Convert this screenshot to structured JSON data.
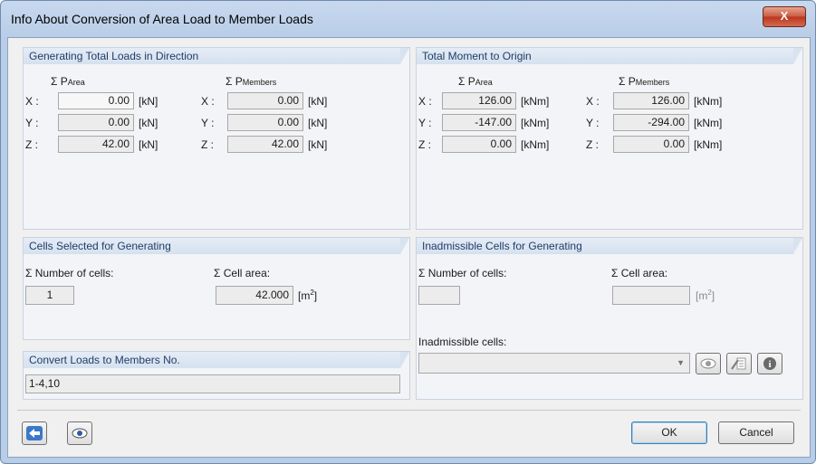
{
  "window": {
    "title": "Info About Conversion of Area Load to Member Loads",
    "close_label": "X"
  },
  "gen_loads": {
    "heading": "Generating Total Loads in Direction",
    "col_area_prefix": "Σ P",
    "col_area_sub": "Area",
    "col_members_prefix": "Σ P",
    "col_members_sub": "Members",
    "rows": [
      {
        "axis": "X :",
        "area": "0.00",
        "area_unit": "[kN]",
        "axis2": "X :",
        "members": "0.00",
        "members_unit": "[kN]"
      },
      {
        "axis": "Y :",
        "area": "0.00",
        "area_unit": "[kN]",
        "axis2": "Y :",
        "members": "0.00",
        "members_unit": "[kN]"
      },
      {
        "axis": "Z :",
        "area": "42.00",
        "area_unit": "[kN]",
        "axis2": "Z :",
        "members": "42.00",
        "members_unit": "[kN]"
      }
    ]
  },
  "moment": {
    "heading": "Total Moment to Origin",
    "col_area_prefix": "Σ P",
    "col_area_sub": "Area",
    "col_members_prefix": "Σ P",
    "col_members_sub": "Members",
    "rows": [
      {
        "axis": "X :",
        "area": "126.00",
        "area_unit": "[kNm]",
        "axis2": "X :",
        "members": "126.00",
        "members_unit": "[kNm]"
      },
      {
        "axis": "Y :",
        "area": "-147.00",
        "area_unit": "[kNm]",
        "axis2": "Y :",
        "members": "-294.00",
        "members_unit": "[kNm]"
      },
      {
        "axis": "Z :",
        "area": "0.00",
        "area_unit": "[kNm]",
        "axis2": "Z :",
        "members": "0.00",
        "members_unit": "[kNm]"
      }
    ]
  },
  "cells_selected": {
    "heading": "Cells Selected for Generating",
    "num_label": "Σ Number of cells:",
    "num_value": "1",
    "area_label": "Σ Cell area:",
    "area_value": "42.000",
    "area_unit": "[m",
    "area_unit_sup": "2",
    "area_unit_end": "]"
  },
  "cells_inadmissible": {
    "heading": "Inadmissible Cells for Generating",
    "num_label": "Σ Number of cells:",
    "num_value": "",
    "area_label": "Σ Cell area:",
    "area_value": "",
    "area_unit": "[m",
    "area_unit_sup": "2",
    "area_unit_end": "]",
    "list_label": "Inadmissible cells:",
    "list_value": ""
  },
  "convert": {
    "heading": "Convert Loads to Members No.",
    "value": "1-4,10"
  },
  "footer": {
    "ok_label": "OK",
    "cancel_label": "Cancel"
  },
  "colors": {
    "title_bar": "#b9cde8",
    "group_header_text": "#1f3d66",
    "close_button": "#c4492c"
  }
}
